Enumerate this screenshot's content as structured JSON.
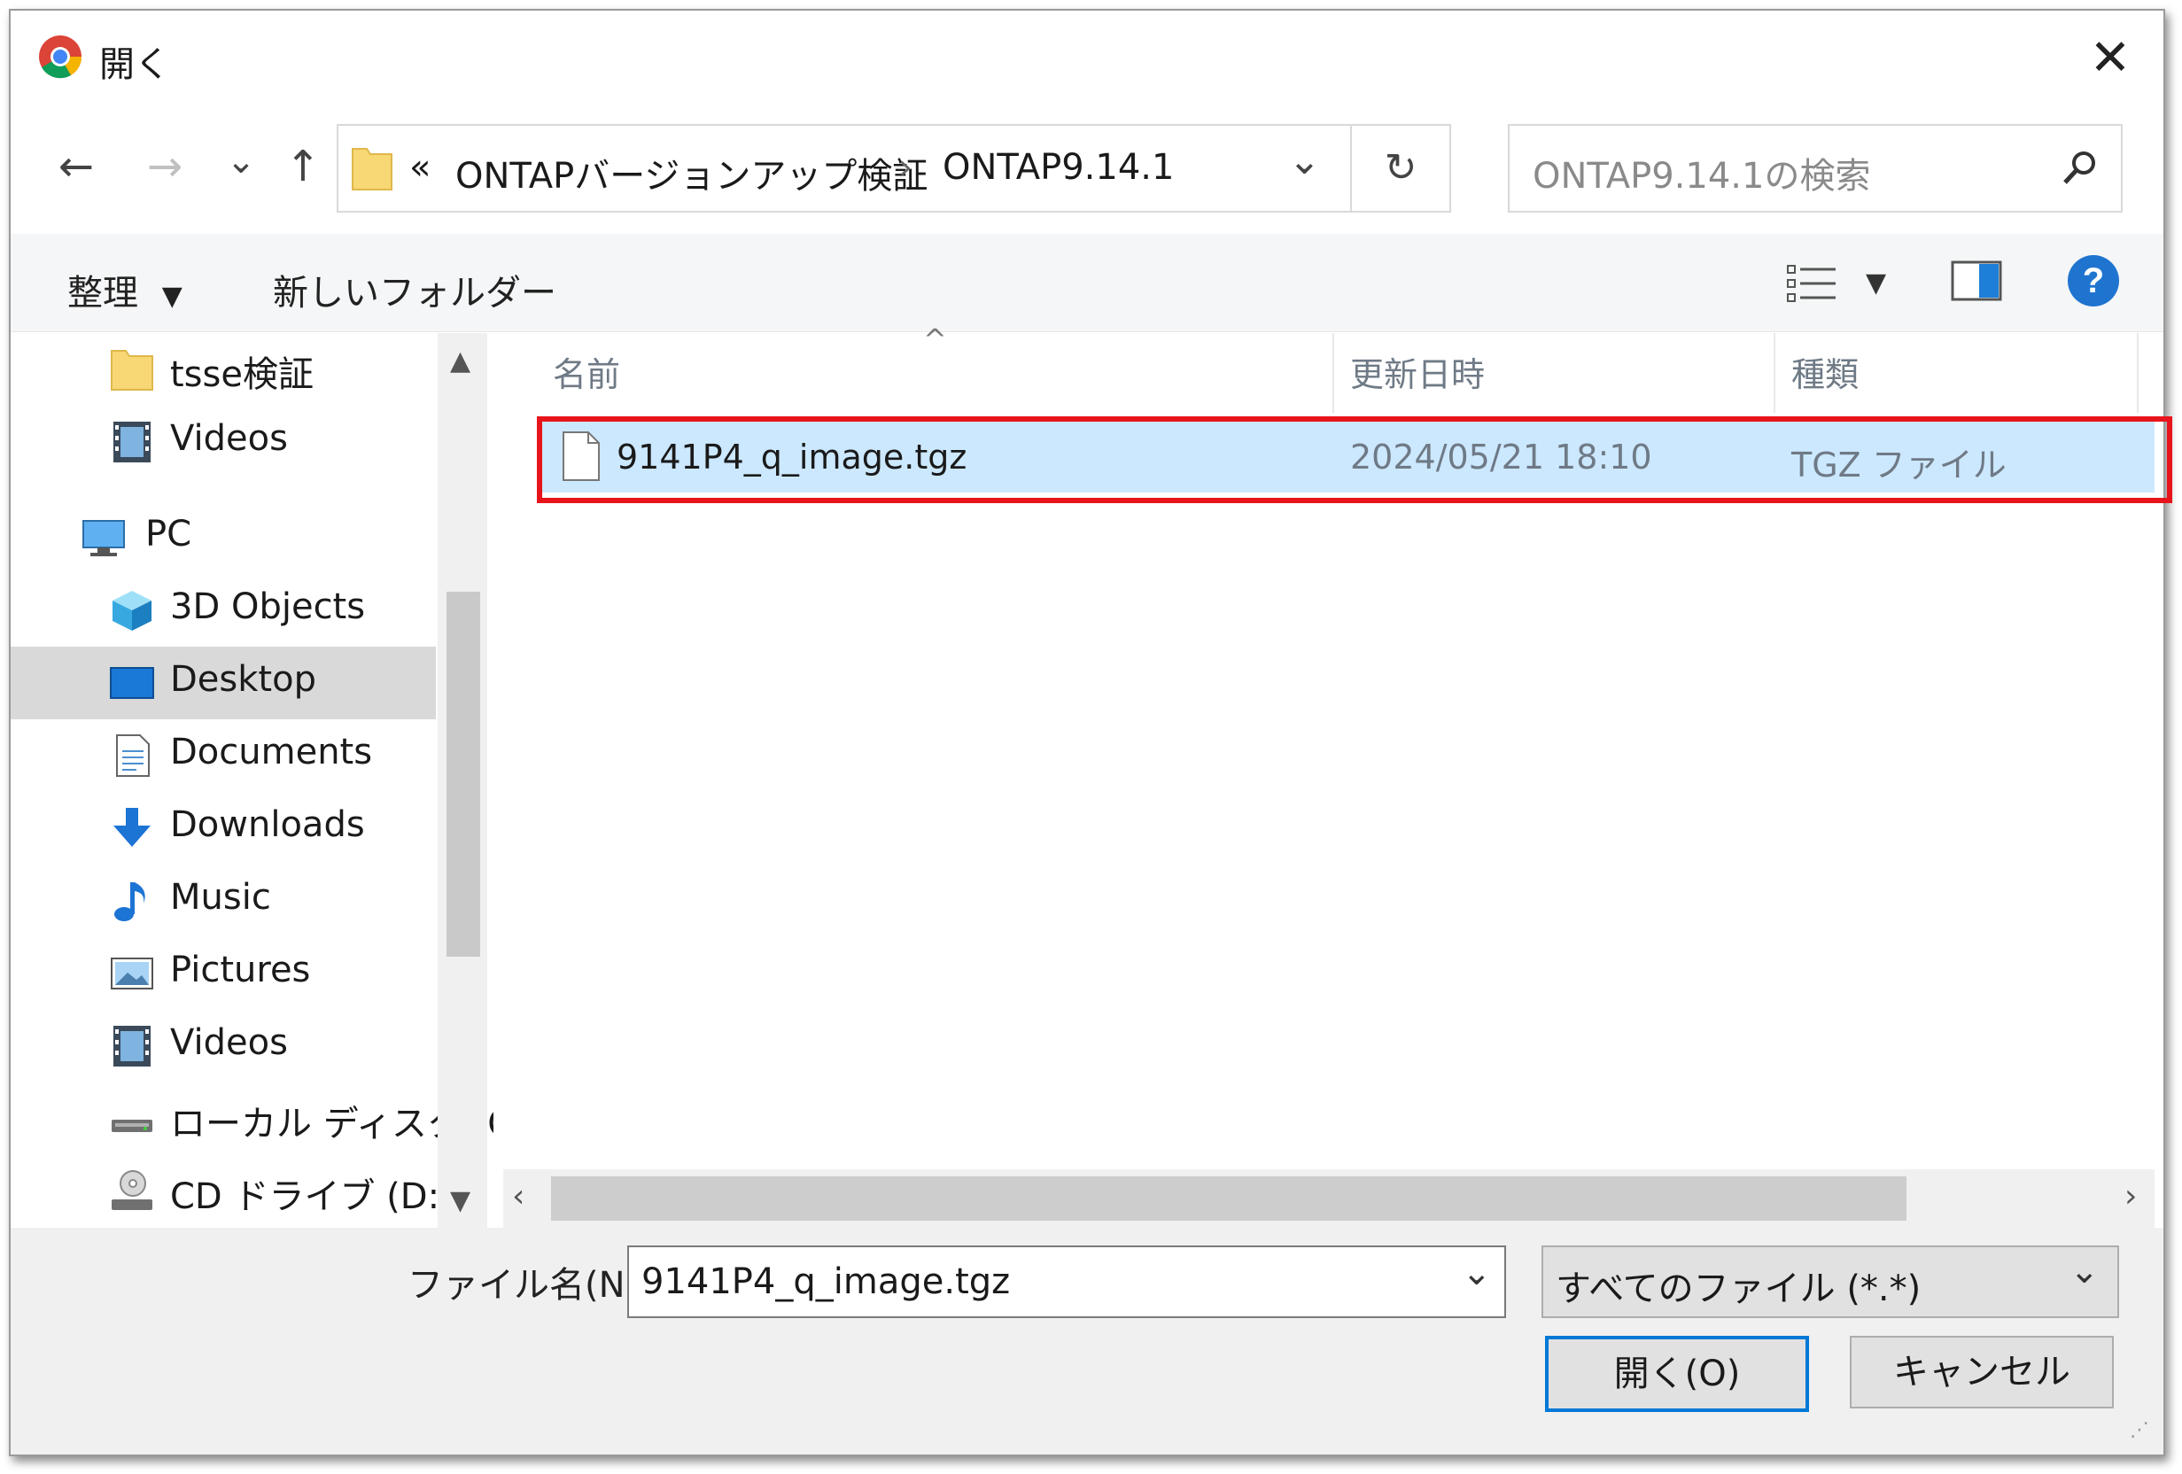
{
  "window": {
    "title": "開く",
    "close_glyph": "✕",
    "accent": "#0078d7"
  },
  "nav": {
    "back": "←",
    "forward": "→",
    "recent": "⌄",
    "up": "↑"
  },
  "address": {
    "chevron": "«",
    "parent": "ONTAPバージョンアップ検証",
    "separator": "›",
    "current": "ONTAP9.14.1",
    "dropdown": "⌄",
    "refresh": "↻"
  },
  "search": {
    "placeholder": "ONTAP9.14.1の検索",
    "icon": "search-icon"
  },
  "toolbar": {
    "organize": "整理",
    "new_folder": "新しいフォルダー",
    "help": "?"
  },
  "sidebar": {
    "items": [
      {
        "label": "tsse検証",
        "icon": "folder-icon"
      },
      {
        "label": "Videos",
        "icon": "videos-icon"
      },
      {
        "label": "PC",
        "icon": "pc-icon"
      },
      {
        "label": "3D Objects",
        "icon": "3d-objects-icon"
      },
      {
        "label": "Desktop",
        "icon": "desktop-icon",
        "selected": true
      },
      {
        "label": "Documents",
        "icon": "documents-icon"
      },
      {
        "label": "Downloads",
        "icon": "downloads-icon"
      },
      {
        "label": "Music",
        "icon": "music-icon"
      },
      {
        "label": "Pictures",
        "icon": "pictures-icon"
      },
      {
        "label": "Videos",
        "icon": "videos-icon"
      },
      {
        "label": "ローカル ディスク (C",
        "icon": "drive-icon"
      },
      {
        "label": "CD ドライブ (D:)",
        "icon": "cd-drive-icon"
      }
    ]
  },
  "file_list": {
    "columns": [
      "名前",
      "更新日時",
      "種類"
    ],
    "rows": [
      {
        "name": "9141P4_q_image.tgz",
        "modified": "2024/05/21 18:10",
        "type": "TGZ ファイル",
        "selected": true
      }
    ],
    "highlight_color": "#e8141b",
    "selection_color": "#cce8ff"
  },
  "bottom": {
    "filename_label": "ファイル名(N):",
    "filename_value": "9141P4_q_image.tgz",
    "filter_value": "すべてのファイル (*.*)",
    "open_label": "開く(O)",
    "cancel_label": "キャンセル"
  }
}
